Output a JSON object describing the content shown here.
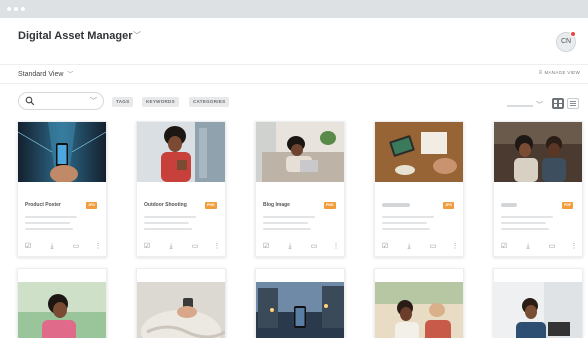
{
  "app": {
    "title": "Digital Asset Manager",
    "user_initials": "CN"
  },
  "toolbar": {
    "view_select": "Standard View",
    "manage_view": "MANAGE VIEW"
  },
  "filters": {
    "search_placeholder": "",
    "chips": [
      "TAGS",
      "KEYWORDS",
      "CATEGORIES"
    ]
  },
  "assets": [
    {
      "name": "Product Poster",
      "format": "JPG"
    },
    {
      "name": "Outdoor Shooting",
      "format": "PNG"
    },
    {
      "name": "Blog Image",
      "format": "PNG"
    },
    {
      "name": "",
      "format": "JPG"
    },
    {
      "name": "",
      "format": "PDF"
    }
  ],
  "colors": {
    "accent_tag": "#f39c3c",
    "notification": "#e5483f",
    "titlebar": "#dde1e4"
  },
  "icons": {
    "card_actions": [
      "checkbox-icon",
      "download-icon",
      "preview-icon",
      "more-icon"
    ]
  }
}
